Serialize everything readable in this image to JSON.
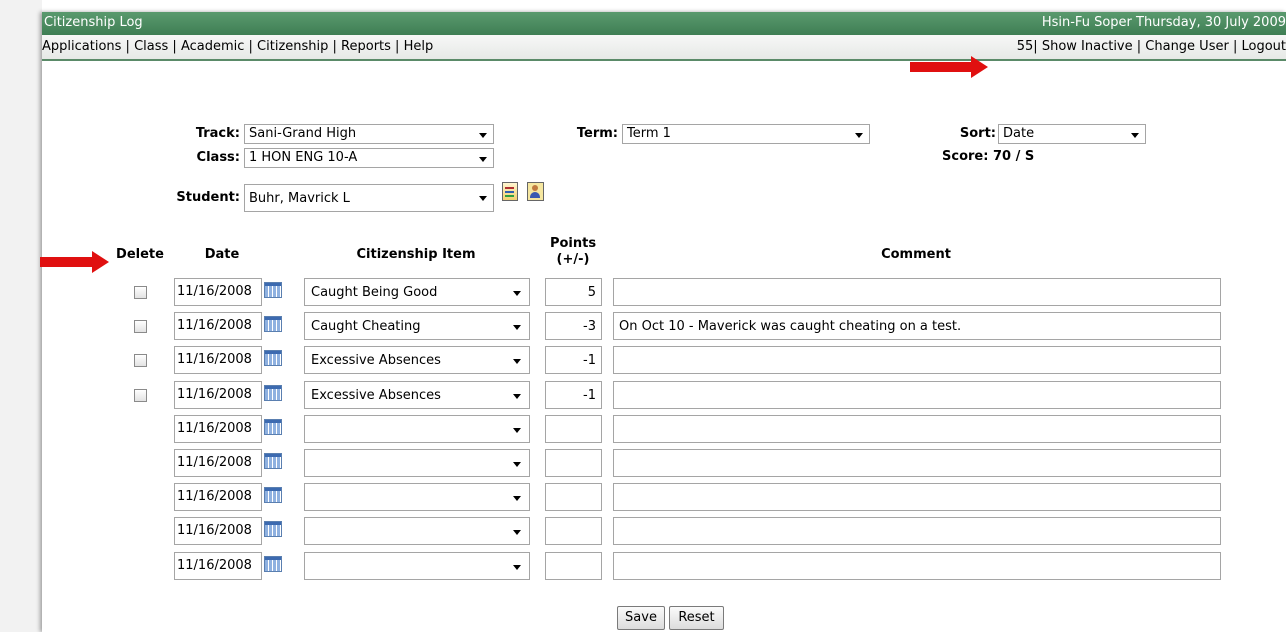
{
  "titlebar": {
    "app_title": "Citizenship Log",
    "user_date": "Hsin-Fu Soper  Thursday, 30 July 2009"
  },
  "menubar": {
    "left_items": [
      "Applications",
      "Class",
      "Academic",
      "Citizenship",
      "Reports",
      "Help"
    ],
    "right_prefix": "55|",
    "right_items": [
      "Show Inactive",
      "Change User",
      "Logout"
    ]
  },
  "filters": {
    "track_label": "Track:",
    "track_value": "Sani-Grand High",
    "class_label": "Class:",
    "class_value": "1 HON ENG 10-A",
    "student_label": "Student:",
    "student_value": "Buhr, Mavrick L",
    "term_label": "Term:",
    "term_value": "Term 1",
    "sort_label": "Sort:",
    "sort_value": "Date",
    "score_text": "Score: 70 / S"
  },
  "table": {
    "headers": {
      "delete": "Delete",
      "date": "Date",
      "item": "Citizenship Item",
      "points_line1": "Points",
      "points_line2": "(+/-)",
      "comment": "Comment"
    },
    "rows": [
      {
        "date": "11/16/2008",
        "item": "Caught Being Good",
        "points": "5",
        "comment": ""
      },
      {
        "date": "11/16/2008",
        "item": "Caught Cheating",
        "points": "-3",
        "comment": "On Oct 10 - Maverick was caught cheating on a test."
      },
      {
        "date": "11/16/2008",
        "item": "Excessive Absences",
        "points": "-1",
        "comment": ""
      },
      {
        "date": "11/16/2008",
        "item": "Excessive Absences",
        "points": "-1",
        "comment": ""
      },
      {
        "date": "11/16/2008",
        "item": "",
        "points": "",
        "comment": ""
      },
      {
        "date": "11/16/2008",
        "item": "",
        "points": "",
        "comment": ""
      },
      {
        "date": "11/16/2008",
        "item": "",
        "points": "",
        "comment": ""
      },
      {
        "date": "11/16/2008",
        "item": "",
        "points": "",
        "comment": ""
      },
      {
        "date": "11/16/2008",
        "item": "",
        "points": "",
        "comment": ""
      }
    ]
  },
  "buttons": {
    "save": "Save",
    "reset": "Reset"
  },
  "colors": {
    "titlebar_green": "#4a8a5e",
    "annotation_arrow": "#e01010"
  },
  "icons": [
    "calendar-icon",
    "report-card-icon",
    "student-profile-icon",
    "dropdown-caret-icon",
    "annotation-arrow"
  ]
}
